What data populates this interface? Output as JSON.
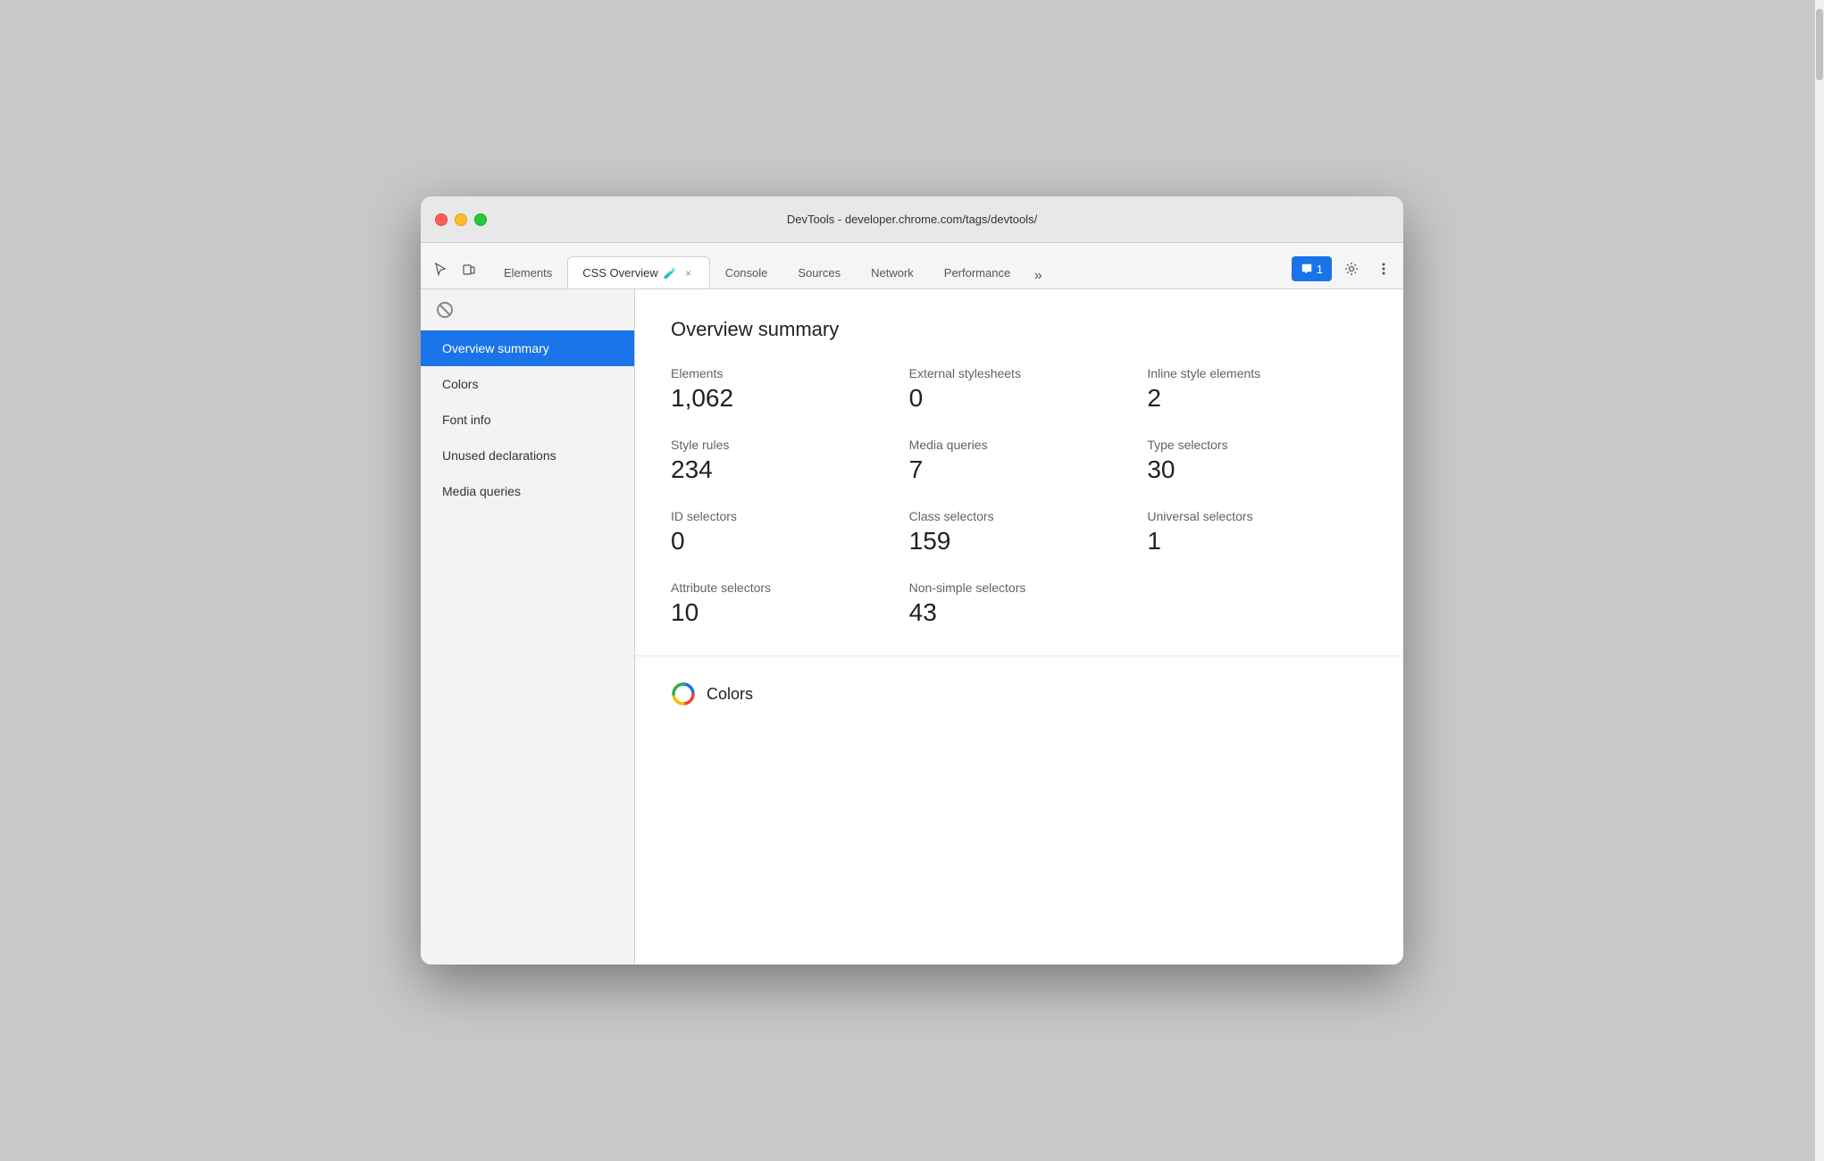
{
  "window": {
    "title": "DevTools - developer.chrome.com/tags/devtools/"
  },
  "tabs": [
    {
      "id": "elements",
      "label": "Elements",
      "active": false,
      "closeable": false
    },
    {
      "id": "css-overview",
      "label": "CSS Overview",
      "active": true,
      "closeable": true,
      "experiment": true
    },
    {
      "id": "console",
      "label": "Console",
      "active": false,
      "closeable": false
    },
    {
      "id": "sources",
      "label": "Sources",
      "active": false,
      "closeable": false
    },
    {
      "id": "network",
      "label": "Network",
      "active": false,
      "closeable": false
    },
    {
      "id": "performance",
      "label": "Performance",
      "active": false,
      "closeable": false
    }
  ],
  "notifications": {
    "count": "1",
    "label": "1"
  },
  "sidebar": {
    "items": [
      {
        "id": "overview-summary",
        "label": "Overview summary",
        "active": true
      },
      {
        "id": "colors",
        "label": "Colors",
        "active": false
      },
      {
        "id": "font-info",
        "label": "Font info",
        "active": false
      },
      {
        "id": "unused-declarations",
        "label": "Unused declarations",
        "active": false
      },
      {
        "id": "media-queries",
        "label": "Media queries",
        "active": false
      }
    ]
  },
  "overview": {
    "title": "Overview summary",
    "stats": [
      {
        "label": "Elements",
        "value": "1,062"
      },
      {
        "label": "External stylesheets",
        "value": "0"
      },
      {
        "label": "Inline style elements",
        "value": "2"
      },
      {
        "label": "Style rules",
        "value": "234"
      },
      {
        "label": "Media queries",
        "value": "7"
      },
      {
        "label": "Type selectors",
        "value": "30"
      },
      {
        "label": "ID selectors",
        "value": "0"
      },
      {
        "label": "Class selectors",
        "value": "159"
      },
      {
        "label": "Universal selectors",
        "value": "1"
      },
      {
        "label": "Attribute selectors",
        "value": "10"
      },
      {
        "label": "Non-simple selectors",
        "value": "43"
      }
    ]
  },
  "colors_section": {
    "title": "Colors"
  }
}
